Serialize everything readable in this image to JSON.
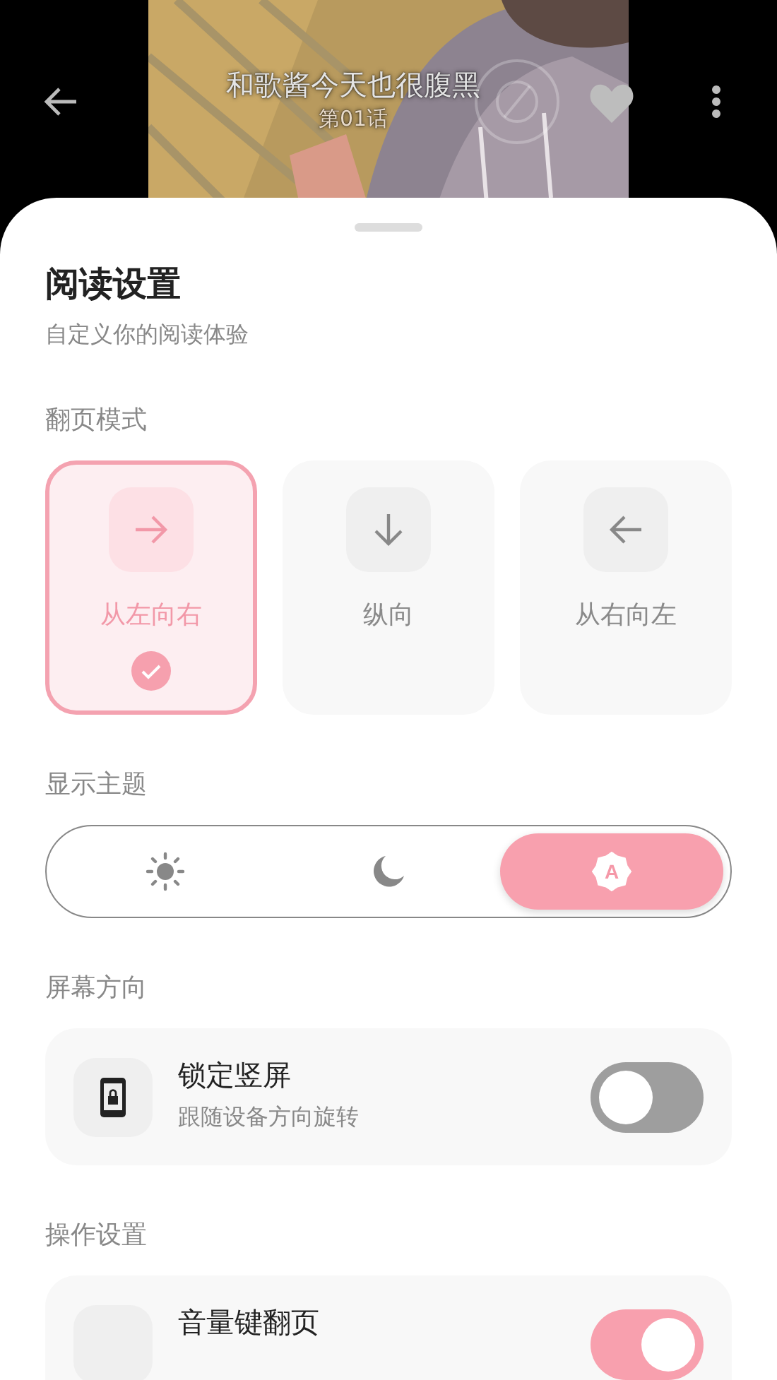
{
  "top_bar": {
    "title": "和歌酱今天也很腹黑",
    "subtitle": "第01话"
  },
  "sheet": {
    "title": "阅读设置",
    "subtitle": "自定义你的阅读体验"
  },
  "page_mode": {
    "label": "翻页模式",
    "options": [
      {
        "label": "从左向右",
        "kind": "right",
        "selected": true
      },
      {
        "label": "纵向",
        "kind": "down",
        "selected": false
      },
      {
        "label": "从右向左",
        "kind": "left",
        "selected": false
      }
    ]
  },
  "theme": {
    "label": "显示主题",
    "options": [
      {
        "kind": "light",
        "selected": false
      },
      {
        "kind": "dark",
        "selected": false
      },
      {
        "kind": "auto",
        "icon_text": "A",
        "selected": true
      }
    ]
  },
  "setting_groups": [
    {
      "label": "屏幕方向",
      "items": [
        {
          "kind": "lock",
          "title": "锁定竖屏",
          "description": "跟随设备方向旋转",
          "on": false
        }
      ]
    },
    {
      "label": "操作设置",
      "items": [
        {
          "kind": "blank",
          "title": "音量键翻页",
          "on": true
        }
      ]
    }
  ]
}
